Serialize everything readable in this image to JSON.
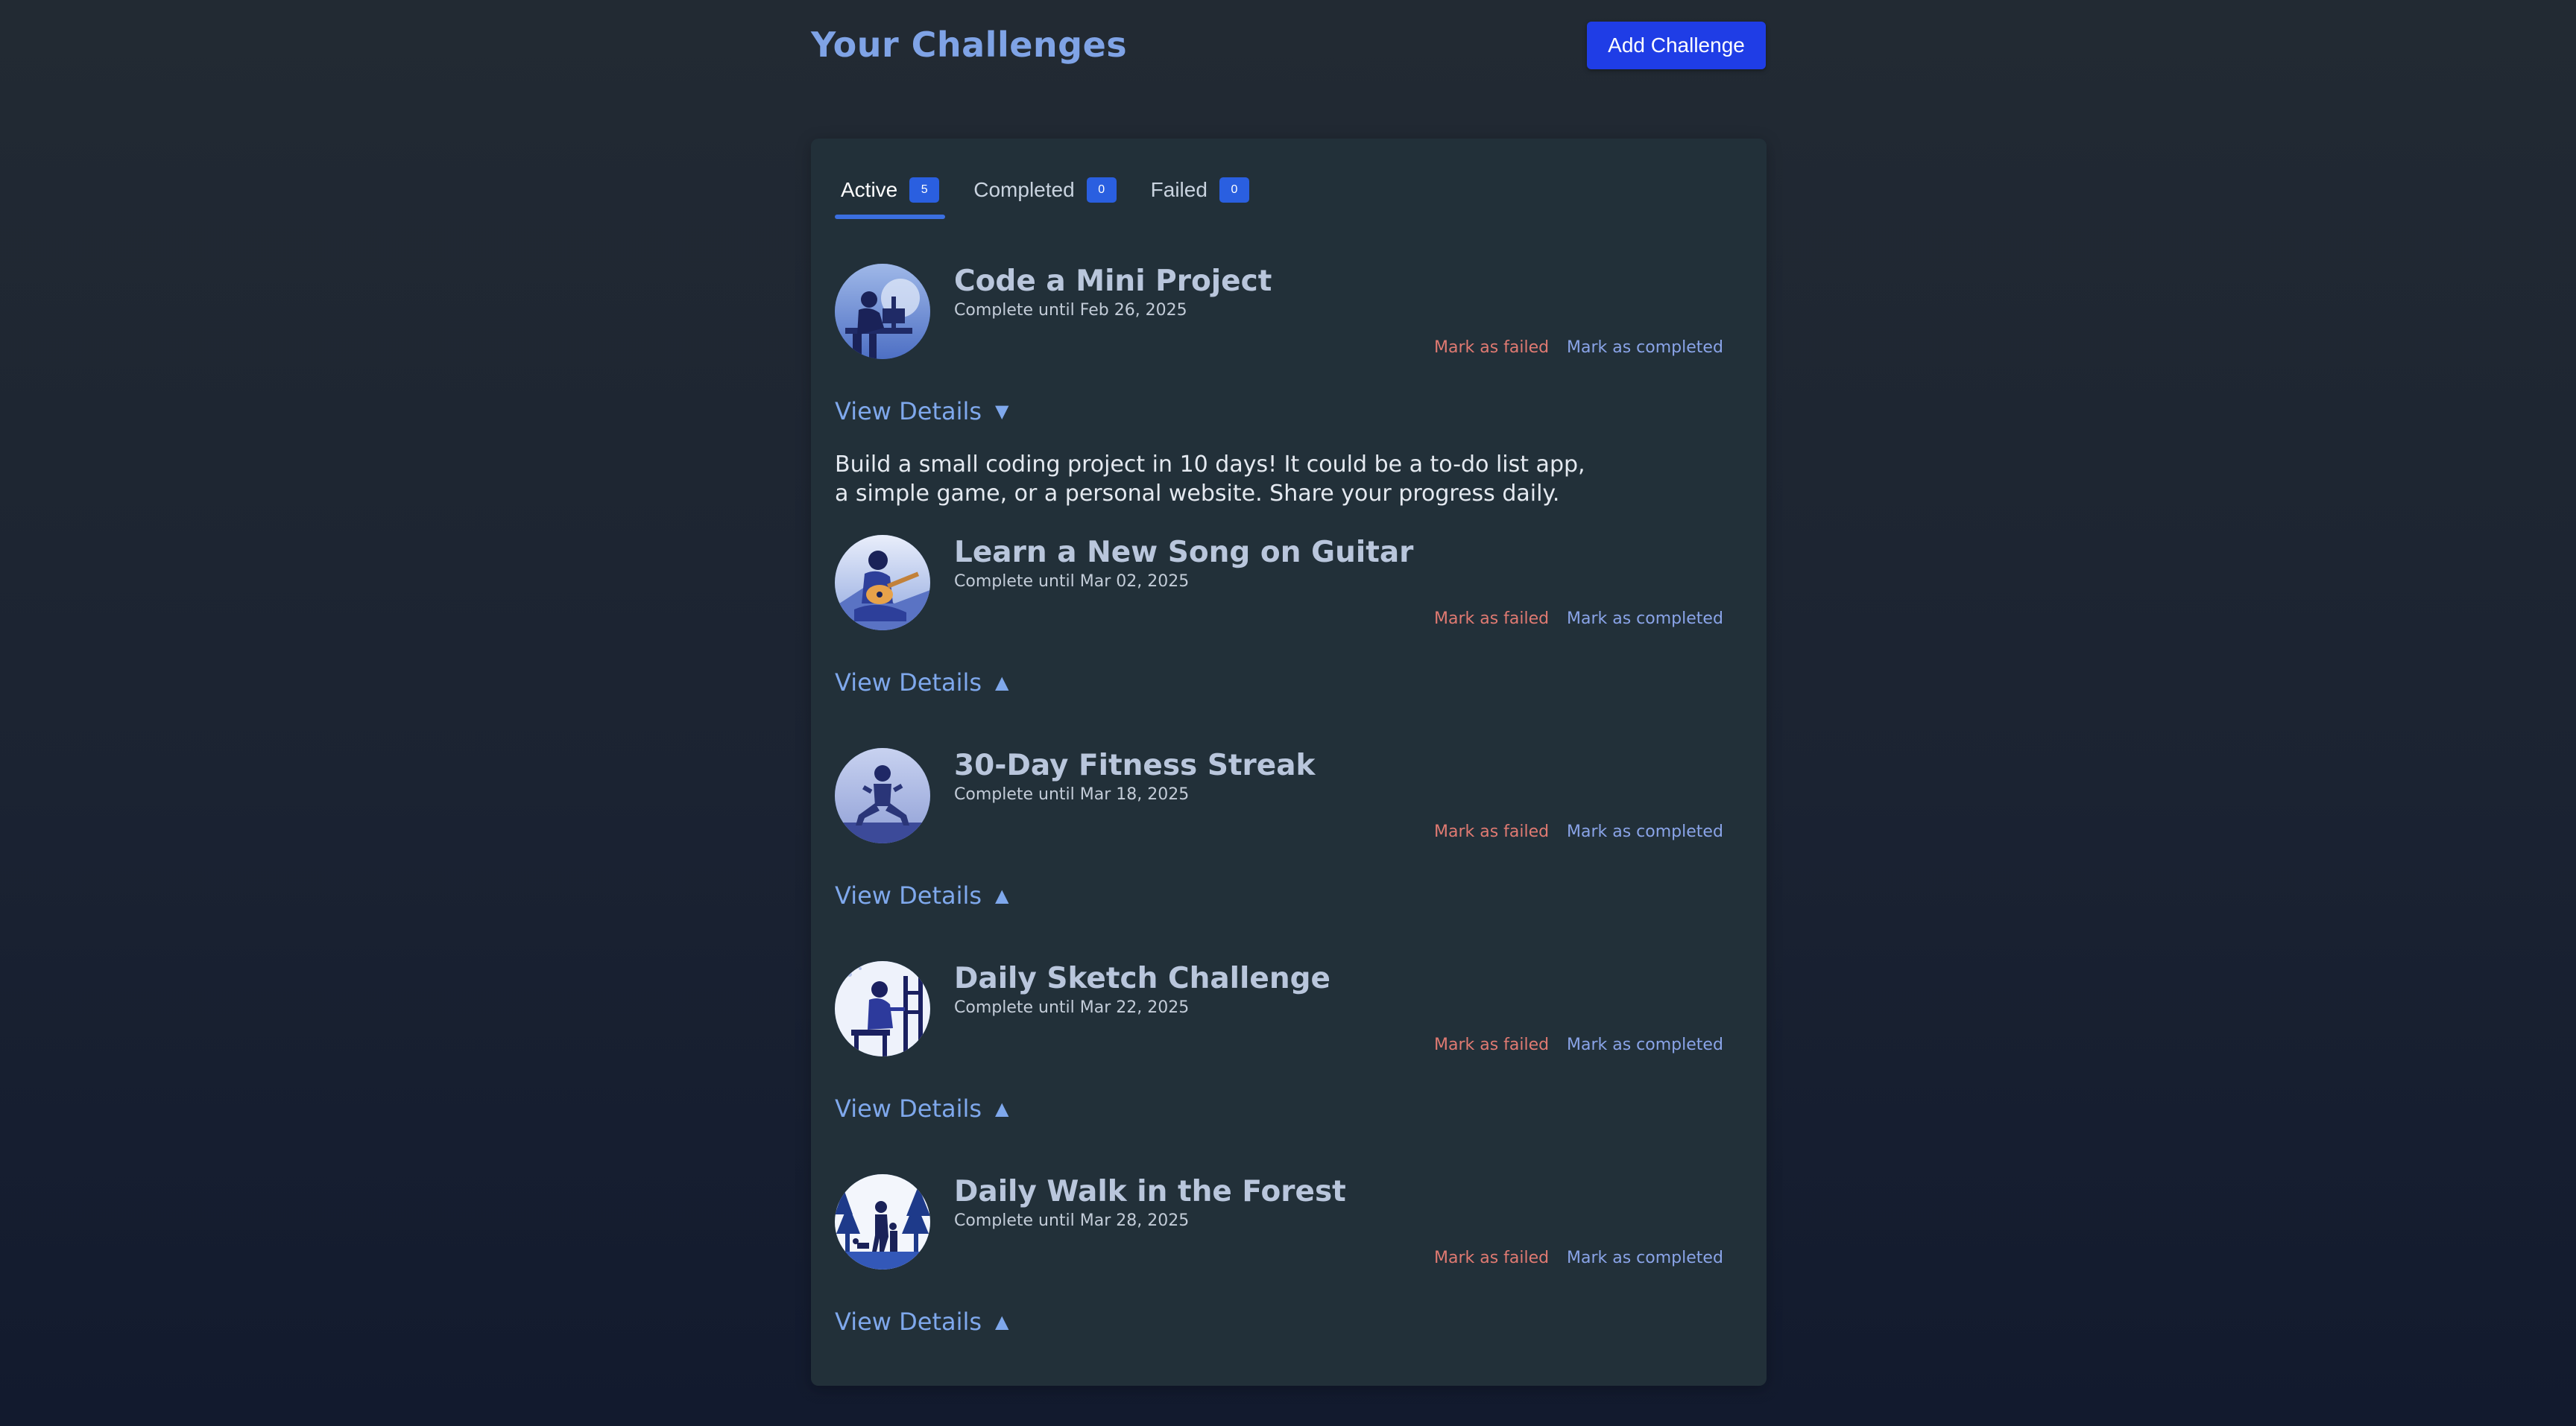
{
  "header": {
    "title": "Your Challenges",
    "add_button_label": "Add Challenge"
  },
  "tabs": [
    {
      "label": "Active",
      "count": "5",
      "active": true
    },
    {
      "label": "Completed",
      "count": "0",
      "active": false
    },
    {
      "label": "Failed",
      "count": "0",
      "active": false
    }
  ],
  "actions": {
    "fail_label": "Mark as failed",
    "complete_label": "Mark as completed",
    "details_label": "View Details"
  },
  "challenges": [
    {
      "title": "Code a Mini Project",
      "due": "Complete until Feb 26, 2025",
      "expanded": true,
      "chevron": "▼",
      "description": "Build a small coding project in 10 days! It could be a to-do list app, a simple game, or a personal website. Share your progress daily.",
      "icon": "coder-at-desk-icon"
    },
    {
      "title": "Learn a New Song on Guitar",
      "due": "Complete until Mar 02, 2025",
      "expanded": false,
      "chevron": "▲",
      "icon": "guitar-player-icon"
    },
    {
      "title": "30-Day Fitness Streak",
      "due": "Complete until Mar 18, 2025",
      "expanded": false,
      "chevron": "▲",
      "icon": "fitness-squat-icon"
    },
    {
      "title": "Daily Sketch Challenge",
      "due": "Complete until Mar 22, 2025",
      "expanded": false,
      "chevron": "▲",
      "icon": "sketching-artist-icon"
    },
    {
      "title": "Daily Walk in the Forest",
      "due": "Complete until Mar 28, 2025",
      "expanded": false,
      "chevron": "▲",
      "icon": "forest-walk-icon"
    }
  ],
  "colors": {
    "accent": "#1f3de6",
    "link": "#7fa8ec",
    "danger": "#e07a72",
    "panel": "#223039"
  }
}
